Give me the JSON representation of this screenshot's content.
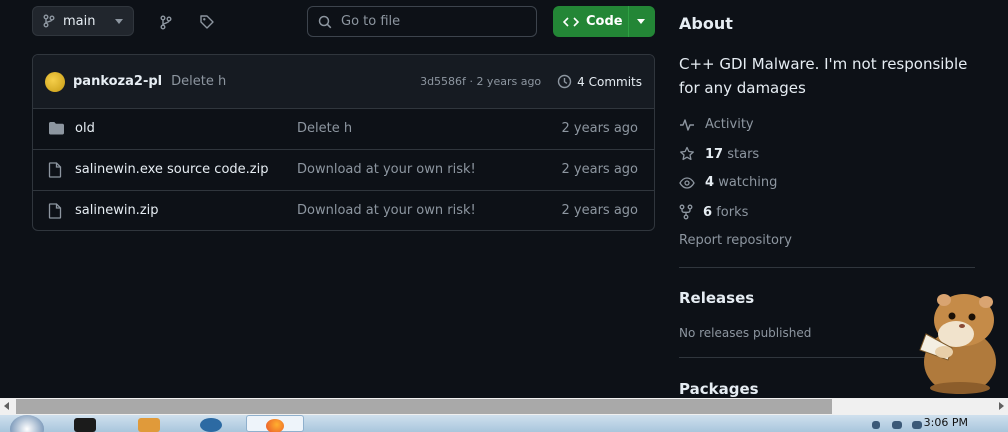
{
  "toolbar": {
    "branch": "main",
    "search_placeholder": "Go to file",
    "code_label": "Code"
  },
  "commit": {
    "author": "pankoza2-pl",
    "message": "Delete h",
    "hash": "3d5586f",
    "sep": "·",
    "age": "2 years ago",
    "commits_label": "4 Commits"
  },
  "files": [
    {
      "name": "old",
      "type": "folder",
      "message": "Delete h",
      "age": "2 years ago"
    },
    {
      "name": "salinewin.exe source code.zip",
      "type": "file",
      "message": "Download at your own risk!",
      "age": "2 years ago"
    },
    {
      "name": "salinewin.zip",
      "type": "file",
      "message": "Download at your own risk!",
      "age": "2 years ago"
    }
  ],
  "about": {
    "heading": "About",
    "description": "C++ GDI Malware. I'm not responsible for any damages",
    "activity": "Activity",
    "stars_count": "17",
    "stars_label": "stars",
    "watching_count": "4",
    "watching_label": "watching",
    "forks_count": "6",
    "forks_label": "forks",
    "report": "Report repository"
  },
  "releases": {
    "heading": "Releases",
    "empty": "No releases published"
  },
  "packages": {
    "heading": "Packages"
  },
  "taskbar": {
    "clock": "3:06 PM"
  },
  "colors": {
    "background": "#0d1117",
    "code_button": "#238636",
    "border": "#30363d",
    "muted_text": "#8d96a0"
  }
}
